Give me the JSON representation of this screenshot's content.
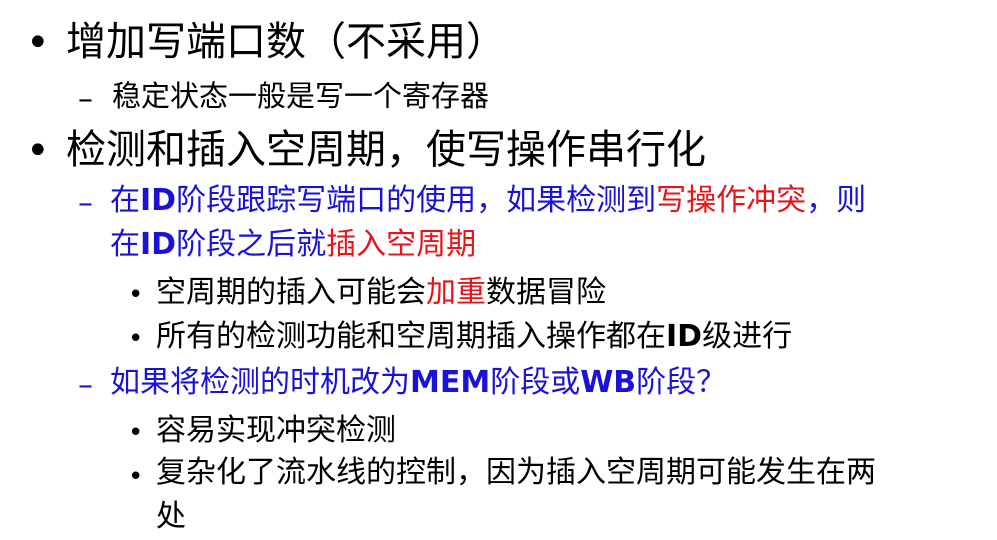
{
  "bullets": {
    "b1": {
      "marker": "•",
      "text": "增加写端口数（不采用）"
    },
    "b1_1": {
      "marker": "–",
      "text": "稳定状态一般是写一个寄存器"
    },
    "b2": {
      "marker": "•",
      "text": "检测和插入空周期，使写操作串行化"
    },
    "b2_1": {
      "marker": "–",
      "line1": {
        "p1": "在",
        "p2": "ID",
        "p3": "阶段跟踪写端口的使用，如果检测到",
        "p4": "写操作冲突",
        "p5": "，则"
      },
      "line2": {
        "p1": "在",
        "p2": "ID",
        "p3": "阶段之后就",
        "p4": "插入空周期"
      }
    },
    "b2_1_1": {
      "marker": "•",
      "p1": "空周期的插入可能会",
      "p2": "加重",
      "p3": "数据冒险"
    },
    "b2_1_2": {
      "marker": "•",
      "p1": "所有的检测功能和空周期插入操作都在",
      "p2": "ID",
      "p3": "级进行"
    },
    "b2_2": {
      "marker": "–",
      "p1": "如果将检测的时机改为",
      "p2": "MEM",
      "p3": "阶段或",
      "p4": "WB",
      "p5": "阶段？"
    },
    "b2_2_1": {
      "marker": "•",
      "text": "容易实现冲突检测"
    },
    "b2_2_2": {
      "marker": "•",
      "line1": "复杂化了流水线的控制，因为插入空周期可能发生在两",
      "line2": "处"
    }
  },
  "colors": {
    "blue": "#1a12d6",
    "red": "#e8141a",
    "text": "#000000",
    "background": "#ffffff"
  }
}
